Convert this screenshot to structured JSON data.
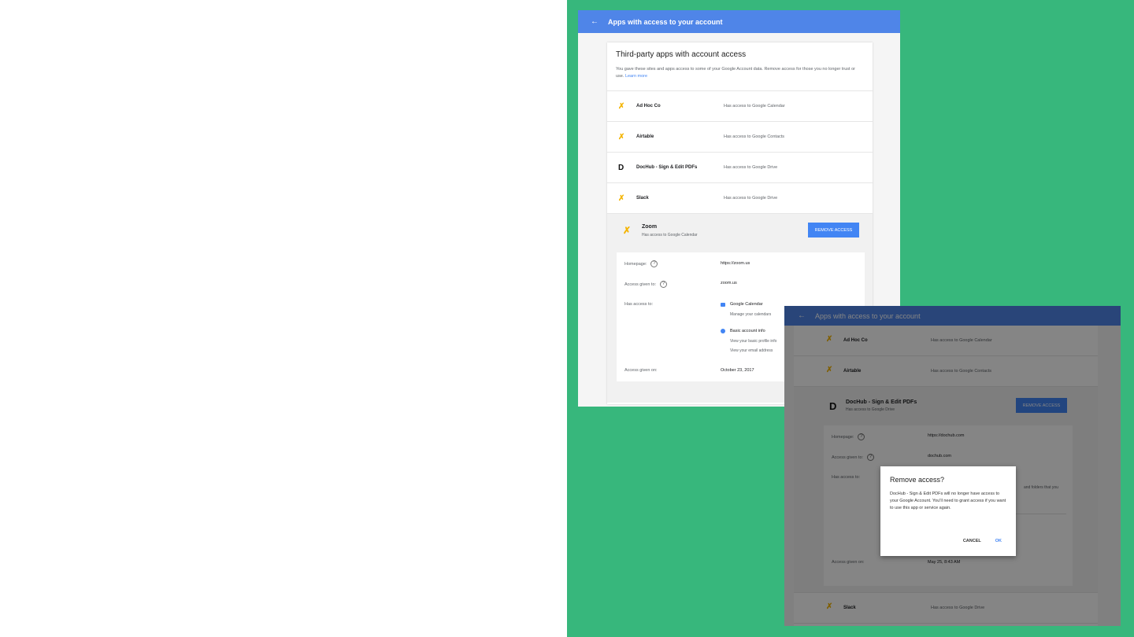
{
  "colors": {
    "background_green": "#37b77c",
    "appbar_blue": "#4f85e8",
    "button_blue": "#4285f4"
  },
  "screen1": {
    "appbar_title": "Apps with access to your account",
    "card_title": "Third-party apps with account access",
    "card_description": "You gave these sites and apps access to some of your Google Account data. Remove access for those you no longer trust or use.",
    "learn_more": "Learn more",
    "apps": [
      {
        "name": "Ad Hoc Co",
        "access": "Has access to Google Calendar",
        "icon": "tools-icon"
      },
      {
        "name": "Airtable",
        "access": "Has access to Google Contacts",
        "icon": "tools-icon"
      },
      {
        "name": "DocHub - Sign & Edit PDFs",
        "access": "Has access to Google Drive",
        "icon": "dochub-icon"
      },
      {
        "name": "Slack",
        "access": "Has access to Google Drive",
        "icon": "tools-icon"
      }
    ],
    "expanded": {
      "name": "Zoom",
      "access": "Has access to Google Calendar",
      "remove_label": "REMOVE ACCESS",
      "homepage_label": "Homepage:",
      "homepage_value": "https://zoom.us",
      "access_given_to_label": "Access given to:",
      "access_given_to_value": "zoom.us",
      "has_access_label": "Has access to:",
      "scope1_title": "Google Calendar",
      "scope1_desc": "Manage your calendars",
      "scope2_title": "Basic account info",
      "scope2_desc1": "View your basic profile info",
      "scope2_desc2": "View your email address",
      "access_given_on_label": "Access given on:",
      "access_given_on_value": "October 23, 2017"
    }
  },
  "screen2": {
    "appbar_title": "Apps with access to your account",
    "apps_top": [
      {
        "name": "Ad Hoc Co",
        "access": "Has access to Google Calendar"
      },
      {
        "name": "Airtable",
        "access": "Has access to Google Contacts"
      }
    ],
    "expanded": {
      "name": "DocHub - Sign & Edit PDFs",
      "access": "Has access to Google Drive",
      "remove_label": "REMOVE ACCESS",
      "homepage_label": "Homepage:",
      "homepage_value": "https://dochub.com",
      "access_given_to_label": "Access given to:",
      "access_given_to_value": "dochub.com",
      "has_access_label": "Has access to:",
      "partial_scope": "and folders that you",
      "access_given_on_label": "Access given on:",
      "access_given_on_value": "May 25, 8:43 AM"
    },
    "apps_bottom": [
      {
        "name": "Slack",
        "access": "Has access to Google Drive"
      }
    ],
    "dialog": {
      "title": "Remove access?",
      "body": "DocHub - Sign & Edit PDFs will no longer have access to your Google Account. You'll need to grant access if you want to use this app or service again.",
      "cancel": "CANCEL",
      "ok": "OK"
    }
  }
}
